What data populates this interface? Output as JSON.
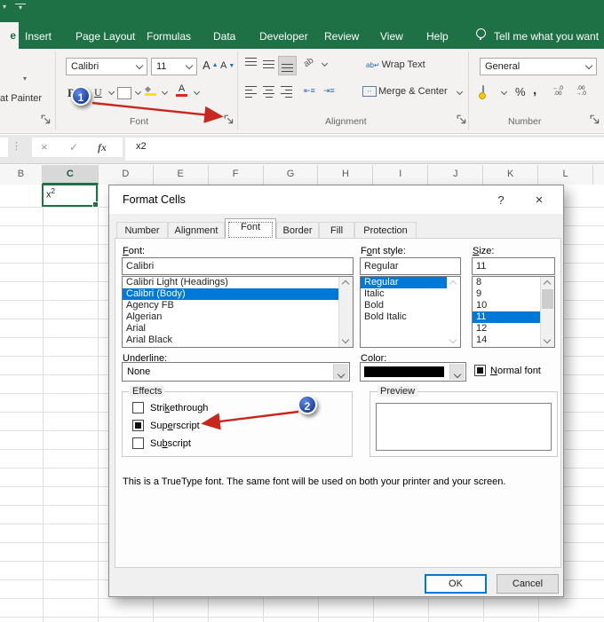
{
  "colors": {
    "excel_green": "#1e7145",
    "selection_blue": "#0078d7",
    "arrow_red": "#c9261d",
    "fill_yellow": "#f7e01a",
    "font_red": "#e0251b",
    "font_color_swatch": "#000000"
  },
  "titlebar": {
    "home_partial": "e",
    "tabs": [
      "Insert",
      "Page Layout",
      "Formulas",
      "Data",
      "Developer",
      "Review",
      "View",
      "Help"
    ],
    "tell_me": "Tell me what you want"
  },
  "ribbon": {
    "clipboard": {
      "partial_label": "at Painter"
    },
    "font": {
      "group_label": "Font",
      "family": "Calibri",
      "size": "11",
      "grow": "A",
      "shrink": "A",
      "bold": "B",
      "italic": "I",
      "underline": "U"
    },
    "alignment": {
      "group_label": "Alignment",
      "orientation": "ab",
      "wrap_text": "Wrap Text",
      "merge_center": "Merge & Center"
    },
    "number": {
      "group_label": "Number",
      "format": "General",
      "percent": "%",
      "comma": ",",
      "increase_decimal": "←.0\n.00",
      "decrease_decimal": ".00\n→.0"
    }
  },
  "formula_bar": {
    "value": "x2",
    "fx": "fx",
    "check": "✓",
    "cancel": "×",
    "dots": "⋮"
  },
  "sheet": {
    "columns": [
      "B",
      "C",
      "D",
      "E",
      "F",
      "G",
      "H",
      "I",
      "J",
      "K",
      "L",
      ""
    ],
    "selected_column": "C",
    "active_cell": {
      "base": "x",
      "sup": "2"
    }
  },
  "dialog": {
    "title": "Format Cells",
    "help": "?",
    "close": "×",
    "tabs": [
      "Number",
      "Alignment",
      "Font",
      "Border",
      "Fill",
      "Protection"
    ],
    "active_tab": "Font",
    "font": {
      "label": {
        "pre": "",
        "mn": "F",
        "post": "ont:"
      },
      "value": "Calibri",
      "items": [
        "Calibri Light (Headings)",
        "Calibri (Body)",
        "Agency FB",
        "Algerian",
        "Arial",
        "Arial Black"
      ],
      "selected": "Calibri (Body)"
    },
    "font_style": {
      "label": {
        "pre": "F",
        "mn": "o",
        "post": "nt style:"
      },
      "value": "Regular",
      "items": [
        "Regular",
        "Italic",
        "Bold",
        "Bold Italic"
      ],
      "selected": "Regular"
    },
    "size": {
      "label": {
        "pre": "",
        "mn": "S",
        "post": "ize:"
      },
      "value": "11",
      "items": [
        "8",
        "9",
        "10",
        "11",
        "12",
        "14"
      ],
      "selected": "11"
    },
    "underline": {
      "label": {
        "pre": "",
        "mn": "U",
        "post": "nderline:"
      },
      "value": "None"
    },
    "color": {
      "label": {
        "pre": "",
        "mn": "C",
        "post": "olor:"
      },
      "swatch": "#000000"
    },
    "normal_font": {
      "label": {
        "pre": "",
        "mn": "N",
        "post": "ormal font"
      },
      "checked": true
    },
    "effects": {
      "group_label": "Effects",
      "items": [
        {
          "pre": "Stri",
          "mn": "k",
          "post": "ethrough",
          "checked": false
        },
        {
          "pre": "Sup",
          "mn": "e",
          "post": "rscript",
          "checked": true
        },
        {
          "pre": "Su",
          "mn": "b",
          "post": "script",
          "checked": false
        }
      ]
    },
    "preview": {
      "group_label": "Preview"
    },
    "note": "This is a TrueType font.  The same font will be used on both your printer and your screen.",
    "buttons": {
      "ok": "OK",
      "cancel": "Cancel"
    }
  },
  "annotations": {
    "step1": "1",
    "step2": "2"
  }
}
